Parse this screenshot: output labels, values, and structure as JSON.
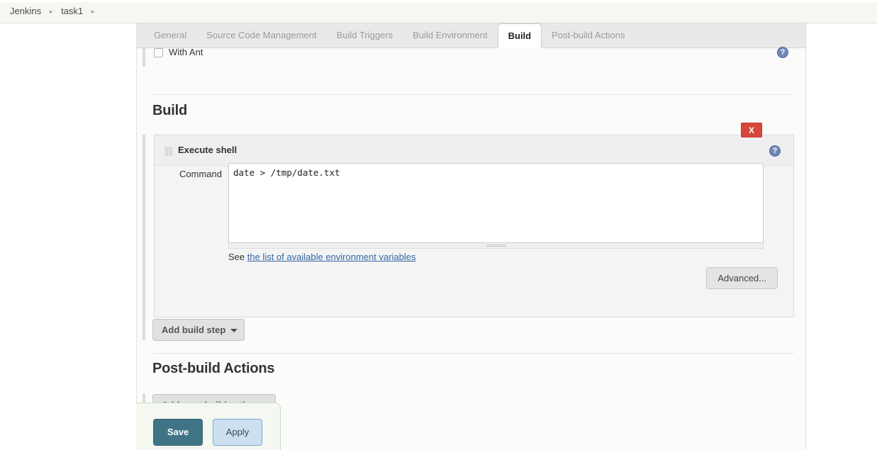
{
  "breadcrumb": {
    "items": [
      "Jenkins",
      "task1"
    ],
    "separator": "▸"
  },
  "tabs": [
    {
      "label": "General",
      "active": false
    },
    {
      "label": "Source Code Management",
      "active": false
    },
    {
      "label": "Build Triggers",
      "active": false
    },
    {
      "label": "Build Environment",
      "active": false
    },
    {
      "label": "Build",
      "active": true
    },
    {
      "label": "Post-build Actions",
      "active": false
    }
  ],
  "build_environment": {
    "with_ant_label": "With Ant",
    "help_glyph": "?"
  },
  "build_section": {
    "title": "Build",
    "step": {
      "title": "Execute shell",
      "delete_label": "X",
      "help_glyph": "?",
      "command_label": "Command",
      "command_value": "date > /tmp/date.txt",
      "env_note_prefix": "See ",
      "env_note_link": "the list of available environment variables",
      "advanced_label": "Advanced..."
    },
    "add_build_step_label": "Add build step"
  },
  "postbuild_section": {
    "title": "Post-build Actions",
    "add_postbuild_label": "Add post-build action"
  },
  "footer": {
    "save_label": "Save",
    "apply_label": "Apply"
  },
  "colors": {
    "accent_save": "#3f7487",
    "accent_apply": "#cde0f2",
    "delete_red": "#d8453a",
    "link_blue": "#3465a4",
    "breadcrumb_bg": "#f5f8f0"
  }
}
